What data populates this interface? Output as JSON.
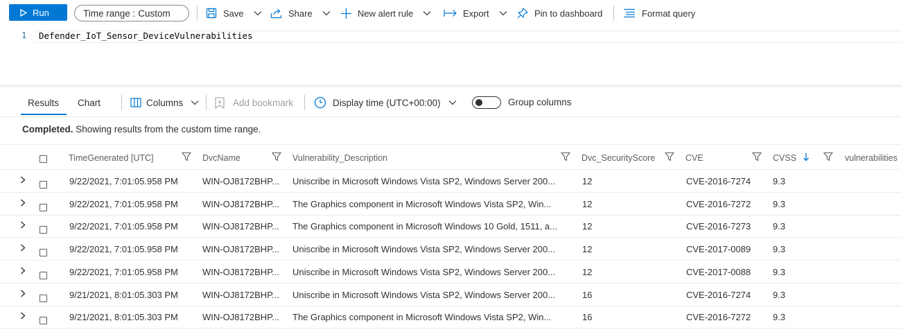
{
  "toolbar": {
    "run_label": "Run",
    "time_range_label": "Time range :",
    "time_range_value": "Custom",
    "save_label": "Save",
    "share_label": "Share",
    "new_alert_rule_label": "New alert rule",
    "export_label": "Export",
    "pin_label": "Pin to dashboard",
    "format_query_label": "Format query"
  },
  "editor": {
    "line_number": "1",
    "query": "Defender_IoT_Sensor_DeviceVulnerabilities"
  },
  "results_toolbar": {
    "tab_results": "Results",
    "tab_chart": "Chart",
    "columns_label": "Columns",
    "add_bookmark_label": "Add bookmark",
    "display_time_label": "Display time (UTC+00:00)",
    "group_columns_label": "Group columns"
  },
  "status": {
    "bold": "Completed.",
    "text": " Showing results from the custom time range."
  },
  "table": {
    "headers": {
      "time": "TimeGenerated [UTC]",
      "dvc_name": "DvcName",
      "vuln_desc": "Vulnerability_Description",
      "security_score": "Dvc_SecurityScore",
      "cve": "CVE",
      "cvss": "CVSS",
      "vulnerabilities": "vulnerabilities"
    },
    "rows": [
      {
        "time": "9/22/2021, 7:01:05.958 PM",
        "dvc": "WIN-OJ8172BHP...",
        "desc": "Uniscribe in Microsoft Windows Vista SP2, Windows Server 200...",
        "score": "12",
        "cve": "CVE-2016-7274",
        "cvss": "9.3"
      },
      {
        "time": "9/22/2021, 7:01:05.958 PM",
        "dvc": "WIN-OJ8172BHP...",
        "desc": "The Graphics component in Microsoft Windows Vista SP2, Win...",
        "score": "12",
        "cve": "CVE-2016-7272",
        "cvss": "9.3"
      },
      {
        "time": "9/22/2021, 7:01:05.958 PM",
        "dvc": "WIN-OJ8172BHP...",
        "desc": "The Graphics component in Microsoft Windows 10 Gold, 1511, a...",
        "score": "12",
        "cve": "CVE-2016-7273",
        "cvss": "9.3"
      },
      {
        "time": "9/22/2021, 7:01:05.958 PM",
        "dvc": "WIN-OJ8172BHP...",
        "desc": "Uniscribe in Microsoft Windows Vista SP2, Windows Server 200...",
        "score": "12",
        "cve": "CVE-2017-0089",
        "cvss": "9.3"
      },
      {
        "time": "9/22/2021, 7:01:05.958 PM",
        "dvc": "WIN-OJ8172BHP...",
        "desc": "Uniscribe in Microsoft Windows Vista SP2, Windows Server 200...",
        "score": "12",
        "cve": "CVE-2017-0088",
        "cvss": "9.3"
      },
      {
        "time": "9/21/2021, 8:01:05.303 PM",
        "dvc": "WIN-OJ8172BHP...",
        "desc": "Uniscribe in Microsoft Windows Vista SP2, Windows Server 200...",
        "score": "16",
        "cve": "CVE-2016-7274",
        "cvss": "9.3"
      },
      {
        "time": "9/21/2021, 8:01:05.303 PM",
        "dvc": "WIN-OJ8172BHP...",
        "desc": "The Graphics component in Microsoft Windows Vista SP2, Win...",
        "score": "16",
        "cve": "CVE-2016-7272",
        "cvss": "9.3"
      }
    ]
  },
  "colors": {
    "accent": "#0078d4",
    "text": "#323130",
    "muted": "#605e5c",
    "disabled": "#a19f9d"
  }
}
